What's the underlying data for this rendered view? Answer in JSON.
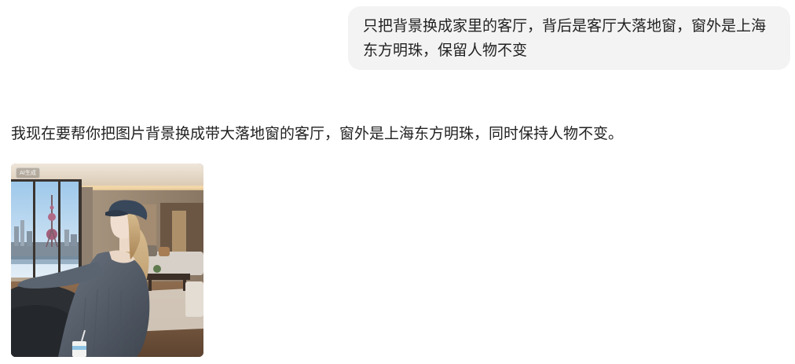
{
  "conversation": {
    "user_message": "只把背景换成家里的客厅，背后是客厅大落地窗，窗外是上海东方明珠，保留人物不变",
    "assistant_message": "我现在要帮你把图片背景换成带大落地窗的客厅，窗外是上海东方明珠，同时保持人物不变。",
    "generated_image": {
      "badge": "AI生成"
    }
  }
}
